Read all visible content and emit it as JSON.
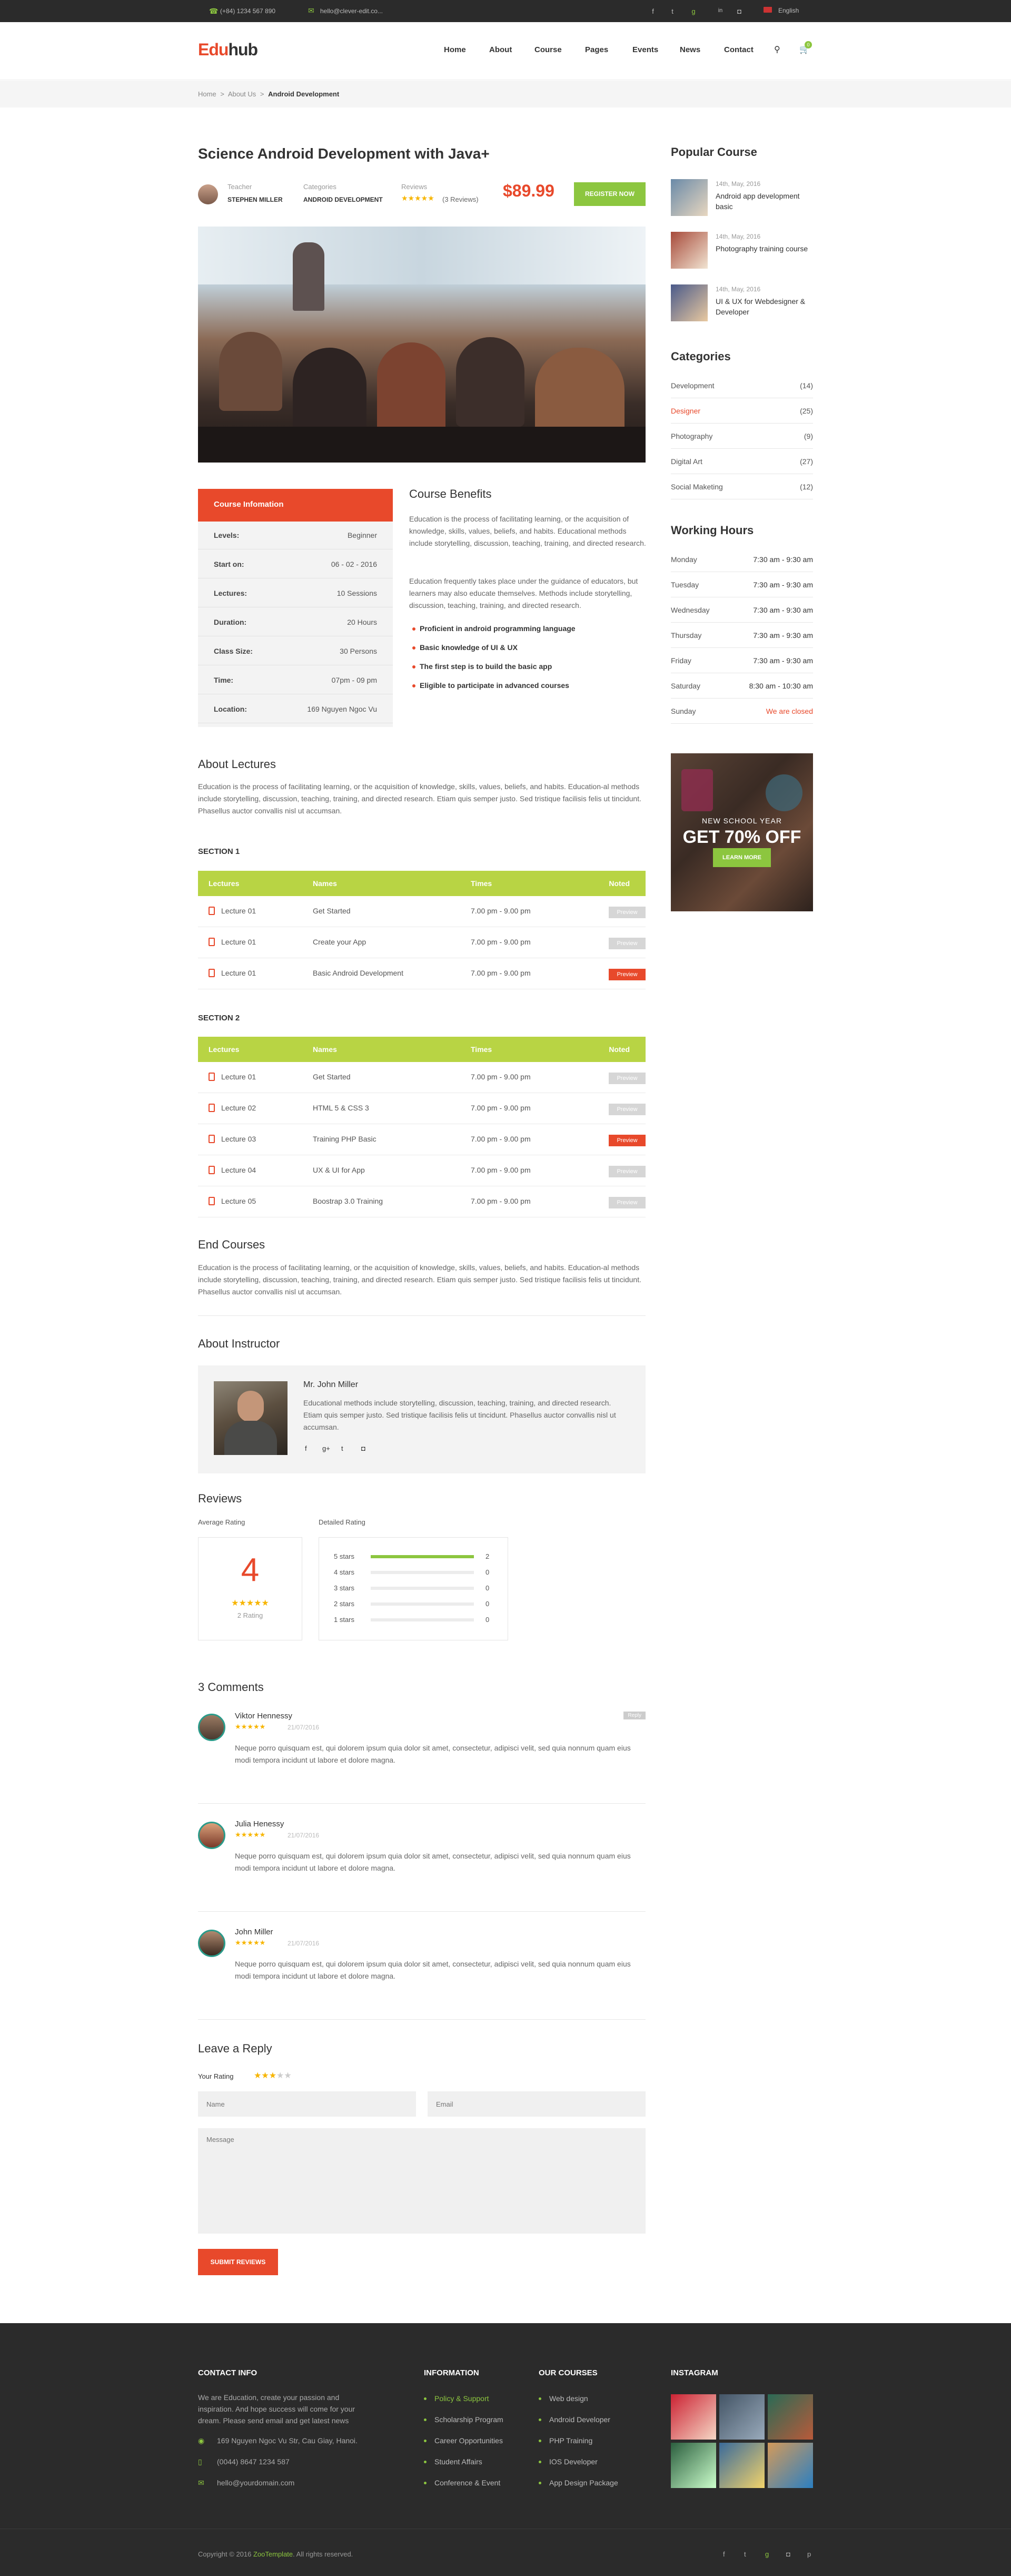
{
  "topbar": {
    "phone": "(+84) 1234 567 890",
    "email": "hello@clever-edit.co...",
    "lang": "English",
    "social": [
      "f",
      "t",
      "g",
      "in",
      "ig"
    ]
  },
  "header": {
    "logo_edu": "Edu",
    "logo_hub": "hub",
    "nav": [
      "Home",
      "About",
      "Course",
      "Pages",
      "Events",
      "News",
      "Contact"
    ],
    "cart_count": "0"
  },
  "breadcrumb": {
    "items": [
      "Home",
      "About Us",
      "Android Development"
    ],
    "sep": ">"
  },
  "course": {
    "title": "Science Android Development with Java+",
    "teacher_label": "Teacher",
    "teacher": "STEPHEN MILLER",
    "cat_label": "Categories",
    "category": "ANDROID DEVELOPMENT",
    "reviews_label": "Reviews",
    "reviews_text": "(3 Reviews)",
    "rating": 5,
    "price": "$89.99",
    "register": "REGISTER NOW"
  },
  "info": {
    "title": "Course Infomation",
    "rows": [
      {
        "k": "Levels:",
        "v": "Beginner"
      },
      {
        "k": "Start on:",
        "v": "06 - 02 - 2016"
      },
      {
        "k": "Lectures:",
        "v": "10 Sessions"
      },
      {
        "k": "Duration:",
        "v": "20 Hours"
      },
      {
        "k": "Class Size:",
        "v": "30 Persons"
      },
      {
        "k": "Time:",
        "v": "07pm - 09 pm"
      },
      {
        "k": "Location:",
        "v": "169 Nguyen Ngoc Vu"
      }
    ]
  },
  "benefits": {
    "title": "Course Benefits",
    "p1": "Education is the process of facilitating learning, or the acquisition of knowledge, skills, values, beliefs, and habits. Educational methods include storytelling, discussion, teaching, training, and directed research.",
    "p2": "Education frequently takes place under the guidance of educators, but learners may also educate themselves. Methods include storytelling, discussion, teaching, training, and directed research.",
    "items": [
      "Proficient in android programming language",
      "Basic knowledge of UI & UX",
      "The first step is to build the basic app",
      "Eligible to participate in advanced courses"
    ]
  },
  "about": {
    "title": "About Lectures",
    "text": "Education is the process of facilitating learning, or the acquisition of knowledge, skills, values, beliefs, and habits. Education-al methods include storytelling, discussion, teaching, training, and directed research. Etiam quis semper justo. Sed tristique facilisis felis ut tincidunt. Phasellus auctor convallis nisl ut accumsan."
  },
  "table_headers": [
    "Lectures",
    "Names",
    "Times",
    "Noted"
  ],
  "section1": {
    "title": "SECTION 1",
    "rows": [
      {
        "lec": "Lecture 01",
        "name": "Get Started",
        "time": "7.00 pm - 9.00 pm",
        "tag": "Preview",
        "hl": false
      },
      {
        "lec": "Lecture 01",
        "name": "Create your App",
        "time": "7.00 pm - 9.00 pm",
        "tag": "Preview",
        "hl": false
      },
      {
        "lec": "Lecture 01",
        "name": "Basic Android Development",
        "time": "7.00 pm - 9.00 pm",
        "tag": "Preview",
        "hl": true
      }
    ]
  },
  "section2": {
    "title": "SECTION 2",
    "rows": [
      {
        "lec": "Lecture 01",
        "name": "Get Started",
        "time": "7.00 pm - 9.00 pm",
        "tag": "Preview",
        "hl": false
      },
      {
        "lec": "Lecture 02",
        "name": "HTML 5 & CSS 3",
        "time": "7.00 pm - 9.00 pm",
        "tag": "Preview",
        "hl": false
      },
      {
        "lec": "Lecture 03",
        "name": "Training PHP Basic",
        "time": "7.00 pm - 9.00 pm",
        "tag": "Preview",
        "hl": true
      },
      {
        "lec": "Lecture 04",
        "name": "UX & UI for App",
        "time": "7.00 pm - 9.00 pm",
        "tag": "Preview",
        "hl": false
      },
      {
        "lec": "Lecture 05",
        "name": "Boostrap 3.0 Training",
        "time": "7.00 pm - 9.00 pm",
        "tag": "Preview",
        "hl": false
      }
    ]
  },
  "end": {
    "title": "End Courses",
    "text": "Education is the process of facilitating learning, or the acquisition of knowledge, skills, values, beliefs, and habits. Education-al methods include storytelling, discussion, teaching, training, and directed research. Etiam quis semper justo. Sed tristique facilisis felis ut tincidunt. Phasellus auctor convallis nisl ut accumsan."
  },
  "instructor": {
    "title": "About Instructor",
    "name": "Mr. John Miller",
    "text": "Educational methods include storytelling, discussion, teaching, training, and directed research. Etiam quis semper justo. Sed tristique facilisis felis ut tincidunt. Phasellus auctor convallis nisl ut accumsan."
  },
  "reviews": {
    "title": "Reviews",
    "avg_label": "Average Rating",
    "detail_label": "Detailed Rating",
    "avg": "4",
    "count_text": "2 Rating",
    "bars": [
      {
        "label": "5 stars",
        "count": "2",
        "fill": 1.0
      },
      {
        "label": "4 stars",
        "count": "0",
        "fill": 0
      },
      {
        "label": "3 stars",
        "count": "0",
        "fill": 0
      },
      {
        "label": "2 stars",
        "count": "0",
        "fill": 0
      },
      {
        "label": "1 stars",
        "count": "0",
        "fill": 0
      }
    ]
  },
  "comments": {
    "title": "3 Comments",
    "reply": "Reply",
    "items": [
      {
        "name": "Viktor Hennessy",
        "date": "21/07/2016",
        "text": "Neque porro quisquam est, qui dolorem ipsum quia dolor sit amet, consectetur, adipisci velit, sed quia nonnum quam eius modi tempora incidunt ut labore et dolore magna."
      },
      {
        "name": "Julia Henessy",
        "date": "21/07/2016",
        "text": "Neque porro quisquam est, qui dolorem ipsum quia dolor sit amet, consectetur, adipisci velit, sed quia nonnum quam eius modi tempora incidunt ut labore et dolore magna."
      },
      {
        "name": "John Miller",
        "date": "21/07/2016",
        "text": "Neque porro quisquam est, qui dolorem ipsum quia dolor sit amet, consectetur, adipisci velit, sed quia nonnum quam eius modi tempora incidunt ut labore et dolore magna."
      }
    ]
  },
  "leave": {
    "title": "Leave a Reply",
    "your_rating": "Your Rating",
    "name_ph": "Name",
    "email_ph": "Email",
    "msg_ph": "Message",
    "submit": "SUBMIT REVIEWS",
    "rating": 3
  },
  "sidebar": {
    "popular_title": "Popular Course",
    "popular": [
      {
        "date": "14th, May, 2016",
        "title": "Android app development basic"
      },
      {
        "date": "14th, May, 2016",
        "title": "Photography training course"
      },
      {
        "date": "14th, May, 2016",
        "title": "UI & UX for Webdesigner & Developer"
      }
    ],
    "cat_title": "Categories",
    "cats": [
      {
        "k": "Development",
        "v": "(14)"
      },
      {
        "k": "Designer",
        "v": "(25)",
        "active": true
      },
      {
        "k": "Photography",
        "v": "(9)"
      },
      {
        "k": "Digital Art",
        "v": "(27)"
      },
      {
        "k": "Social Maketing",
        "v": "(12)"
      }
    ],
    "hours_title": "Working Hours",
    "hours": [
      {
        "k": "Monday",
        "v": "7:30 am - 9:30 am"
      },
      {
        "k": "Tuesday",
        "v": "7:30 am - 9:30 am"
      },
      {
        "k": "Wednesday",
        "v": "7:30 am - 9:30 am"
      },
      {
        "k": "Thursday",
        "v": "7:30 am - 9:30 am"
      },
      {
        "k": "Friday",
        "v": "7:30 am - 9:30 am"
      },
      {
        "k": "Saturday",
        "v": "8:30 am - 10:30 am"
      },
      {
        "k": "Sunday",
        "v": "We are closed"
      }
    ],
    "banner_small": "NEW SCHOOL YEAR",
    "banner_big": "GET 70% OFF",
    "banner_btn": "LEARN MORE"
  },
  "footer": {
    "contact_title": "CONTACT INFO",
    "contact_text": "We are Education, create your passion and inspiration. And hope success will come for your dream. Please send email and get latest news",
    "address": "169 Nguyen Ngoc Vu Str, Cau Giay, Hanoi.",
    "phone": "(0044) 8647 1234 587",
    "mail": "hello@yourdomain.com",
    "info_title": "INFORMATION",
    "info": [
      "Policy & Support",
      "Scholarship Program",
      "Career Opportunities",
      "Student Affairs",
      "Conference & Event"
    ],
    "courses_title": "OUR COURSES",
    "courses": [
      "Web design",
      "Android Developer",
      "PHP Training",
      "IOS Developer",
      "App Design Package"
    ],
    "insta_title": "INSTAGRAM",
    "copyright": "Copyright © 2016",
    "copyright_brand": "ZooTemplate",
    "copyright_end": ". All rights reserved."
  }
}
